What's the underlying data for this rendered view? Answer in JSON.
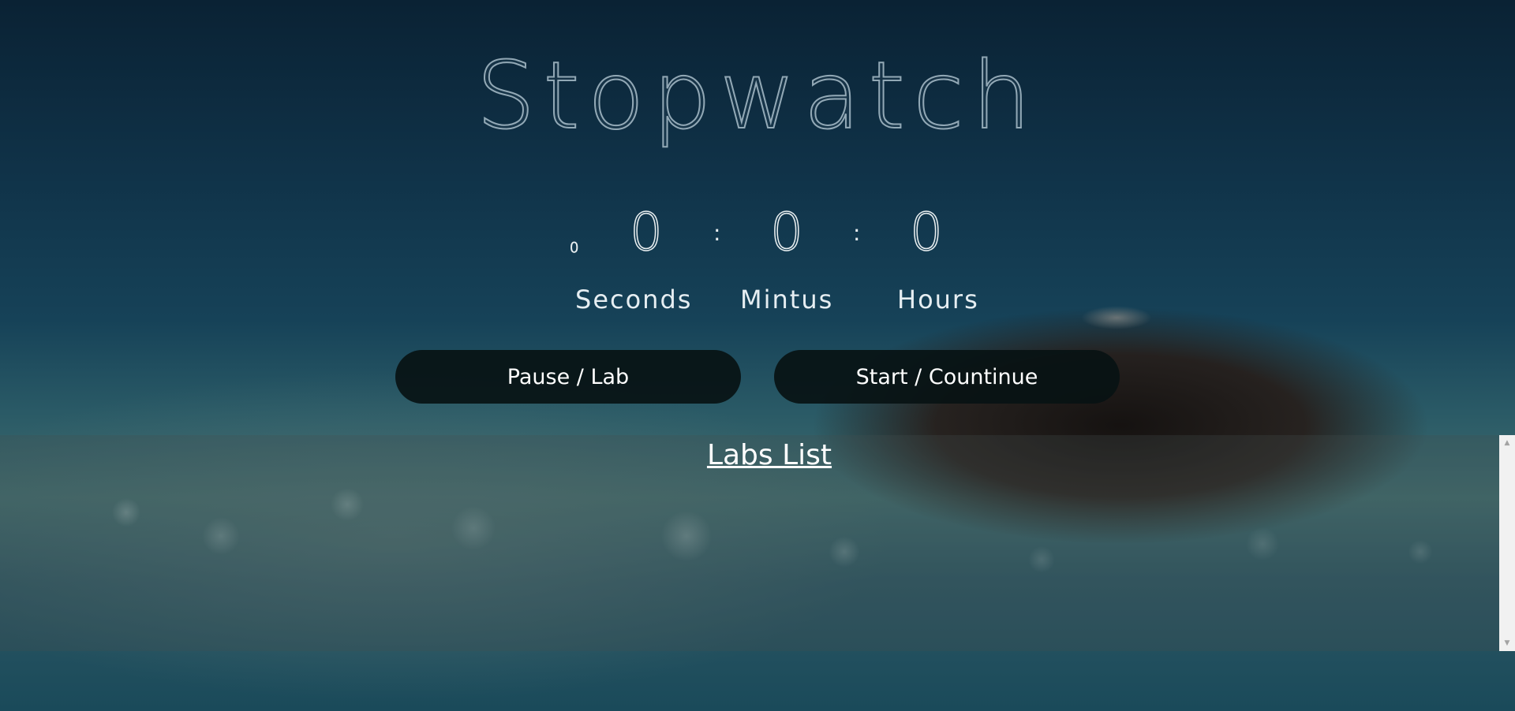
{
  "app": {
    "title": "Stopwatch"
  },
  "timer": {
    "milliseconds": "0",
    "seconds": "0",
    "minutes": "0",
    "hours": "0",
    "separator": ":"
  },
  "labels": {
    "seconds": "Seconds",
    "minutes": "Mintus",
    "hours": "Hours"
  },
  "buttons": {
    "pause": "Pause / Lab",
    "start": "Start / Countinue"
  },
  "labs": {
    "title": "Labs List"
  },
  "icons": {
    "scroll_up": "scroll-up-arrow-icon",
    "scroll_down": "scroll-down-arrow-icon"
  },
  "colors": {
    "button_bg": "#081214",
    "text": "#ffffff"
  }
}
